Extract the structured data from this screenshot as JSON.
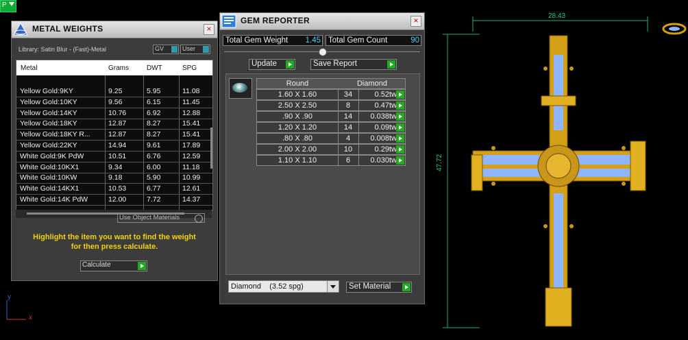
{
  "topbar": {
    "tab_label": "P"
  },
  "metal_weights": {
    "title": "METAL WEIGHTS",
    "library": "Library: Satin Blur - (Fast)-Metal",
    "gv_label": "GV",
    "user_label": "User",
    "columns": [
      "Metal",
      "Grams",
      "DWT",
      "SPG"
    ],
    "rows": [
      [
        "Yellow Gold:9KY",
        "9.25",
        "5.95",
        "11.08"
      ],
      [
        "Yellow Gold:10KY",
        "9.56",
        "6.15",
        "11.45"
      ],
      [
        "Yellow Gold:14KY",
        "10.76",
        "6.92",
        "12.88"
      ],
      [
        "Yellow Gold:18KY",
        "12.87",
        "8.27",
        "15.41"
      ],
      [
        "Yellow Gold:18KY R...",
        "12.87",
        "8.27",
        "15.41"
      ],
      [
        "Yellow Gold:22KY",
        "14.94",
        "9.61",
        "17.89"
      ],
      [
        "White Gold:9K PdW",
        "10.51",
        "6.76",
        "12.59"
      ],
      [
        "White Gold:10KX1",
        "9.34",
        "6.00",
        "11.18"
      ],
      [
        "White Gold:10KW",
        "9.18",
        "5.90",
        "10.99"
      ],
      [
        "White Gold:14KX1",
        "10.53",
        "6.77",
        "12.61"
      ],
      [
        "White Gold:14K PdW",
        "12.00",
        "7.72",
        "14.37"
      ]
    ],
    "use_object_materials": "Use Object Materials",
    "hint_line1": "Highlight the item you want to find the weight",
    "hint_line2": "for then press calculate.",
    "calculate_label": "Calculate"
  },
  "gem_reporter": {
    "title": "GEM REPORTER",
    "total_weight_label": "Total Gem Weight",
    "total_weight_value": "1.45",
    "total_count_label": "Total Gem Count",
    "total_count_value": "90",
    "update_label": "Update",
    "save_report_label": "Save Report",
    "col_shape": "Round",
    "col_material": "Diamond",
    "rows": [
      [
        "1.60 X 1.60",
        "34",
        "0.52tw"
      ],
      [
        "2.50 X 2.50",
        "8",
        "0.47tw"
      ],
      [
        ".90 X .90",
        "14",
        "0.038tw"
      ],
      [
        "1.20 X 1.20",
        "14",
        "0.09tw"
      ],
      [
        ".80 X .80",
        "4",
        "0.008tw"
      ],
      [
        "2.00 X 2.00",
        "10",
        "0.29tw"
      ],
      [
        "1.10 X 1.10",
        "6",
        "0.030tw"
      ]
    ],
    "material_select": "Diamond    (3.52 spg)",
    "set_material_label": "Set Material"
  },
  "viewport": {
    "width_dim": "28.43",
    "height_dim": "47.72",
    "axis_y": "y",
    "axis_x": "x"
  }
}
